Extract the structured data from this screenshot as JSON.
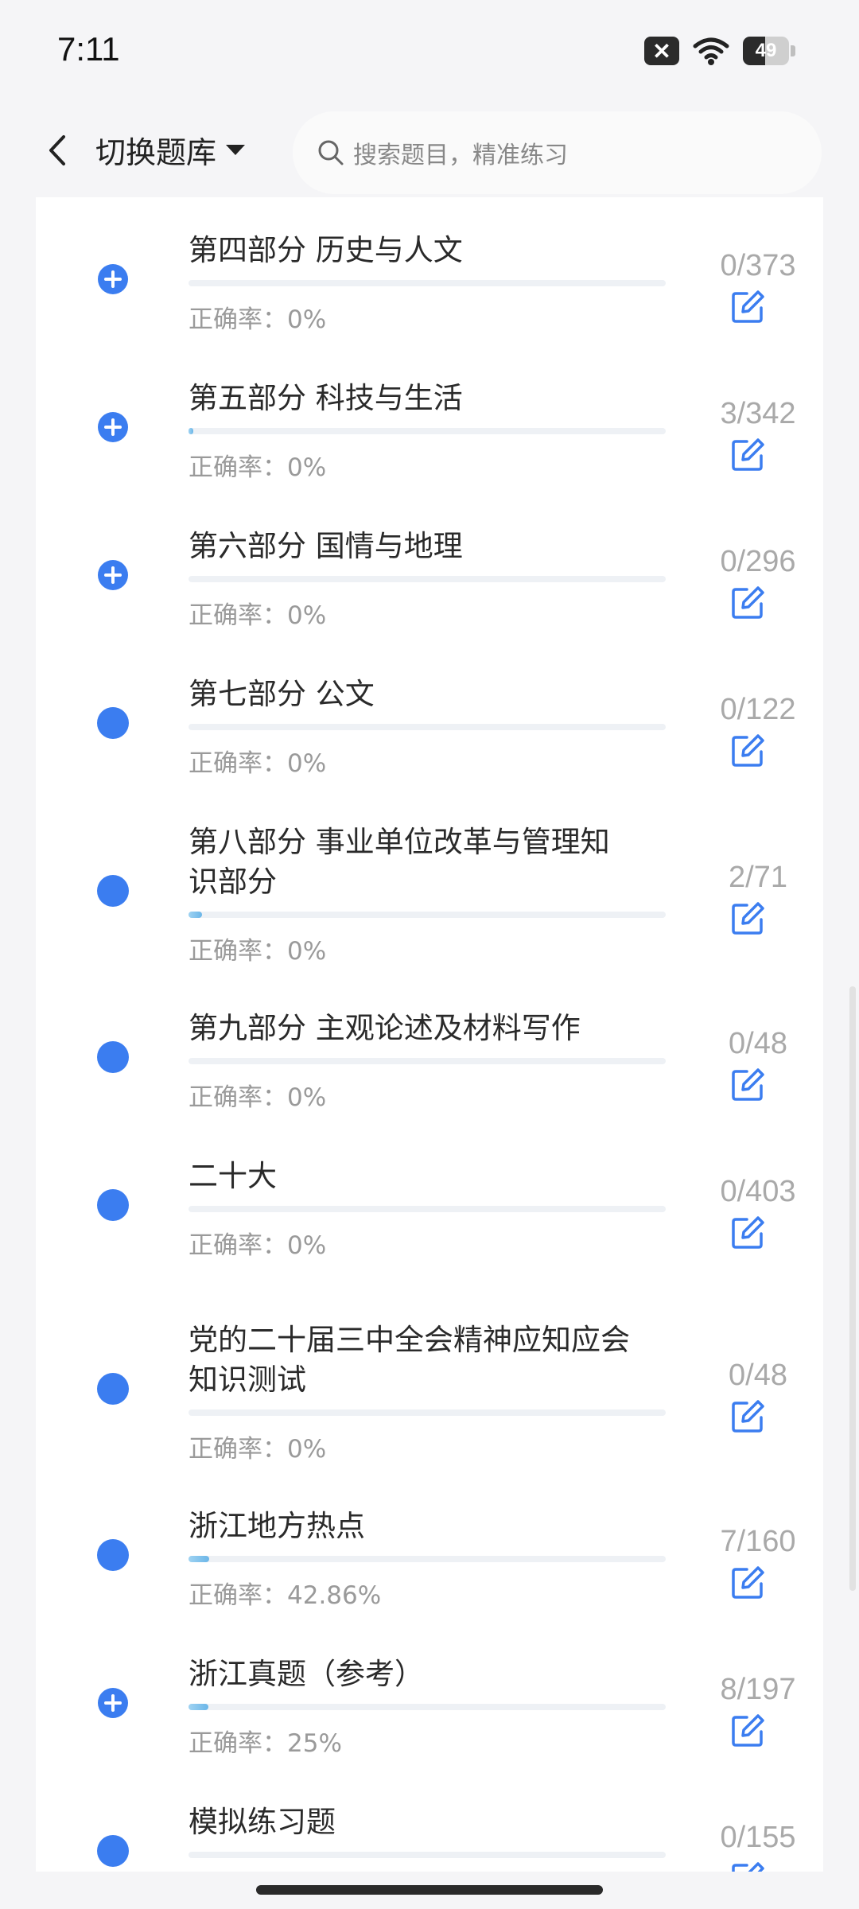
{
  "status_bar": {
    "time": "7:11",
    "battery_level": "49",
    "battery_fraction": 0.49
  },
  "header": {
    "back_icon": "back-arrow-icon",
    "switch_label": "切换题库",
    "search_placeholder": "搜索题目，精准练习"
  },
  "colors": {
    "accent": "#3b7df0",
    "progress": "#6bb6e8",
    "muted_text": "#9a9a9a"
  },
  "rows": [
    {
      "title": "第四部分 历史与人文",
      "accuracy": "正确率：0%",
      "count": "0/373",
      "progress": 0.0,
      "icon": "plus-circle-icon"
    },
    {
      "title": "第五部分 科技与生活",
      "accuracy": "正确率：0%",
      "count": "3/342",
      "progress": 0.009,
      "icon": "plus-circle-icon"
    },
    {
      "title": "第六部分 国情与地理",
      "accuracy": "正确率：0%",
      "count": "0/296",
      "progress": 0.0,
      "icon": "plus-circle-icon"
    },
    {
      "title": "第七部分 公文",
      "accuracy": "正确率：0%",
      "count": "0/122",
      "progress": 0.0,
      "icon": "dot-icon"
    },
    {
      "title": "第八部分 事业单位改革与管理知识部分",
      "accuracy": "正确率：0%",
      "count": "2/71",
      "progress": 0.028,
      "icon": "dot-icon"
    },
    {
      "title": "第九部分 主观论述及材料写作",
      "accuracy": "正确率：0%",
      "count": "0/48",
      "progress": 0.0,
      "icon": "dot-icon"
    },
    {
      "title": "二十大",
      "accuracy": "正确率：0%",
      "count": "0/403",
      "progress": 0.0,
      "icon": "dot-icon"
    },
    {
      "title": "党的二十届三中全会精神应知应会知识测试",
      "accuracy": "正确率：0%",
      "count": "0/48",
      "progress": 0.0,
      "icon": "dot-icon"
    },
    {
      "title": "浙江地方热点",
      "accuracy": "正确率：42.86%",
      "count": "7/160",
      "progress": 0.044,
      "icon": "dot-icon"
    },
    {
      "title": "浙江真题（参考）",
      "accuracy": "正确率：25%",
      "count": "8/197",
      "progress": 0.041,
      "icon": "plus-circle-icon"
    },
    {
      "title": "模拟练习题",
      "accuracy": "",
      "count": "0/155",
      "progress": 0.0,
      "icon": "dot-icon"
    }
  ]
}
